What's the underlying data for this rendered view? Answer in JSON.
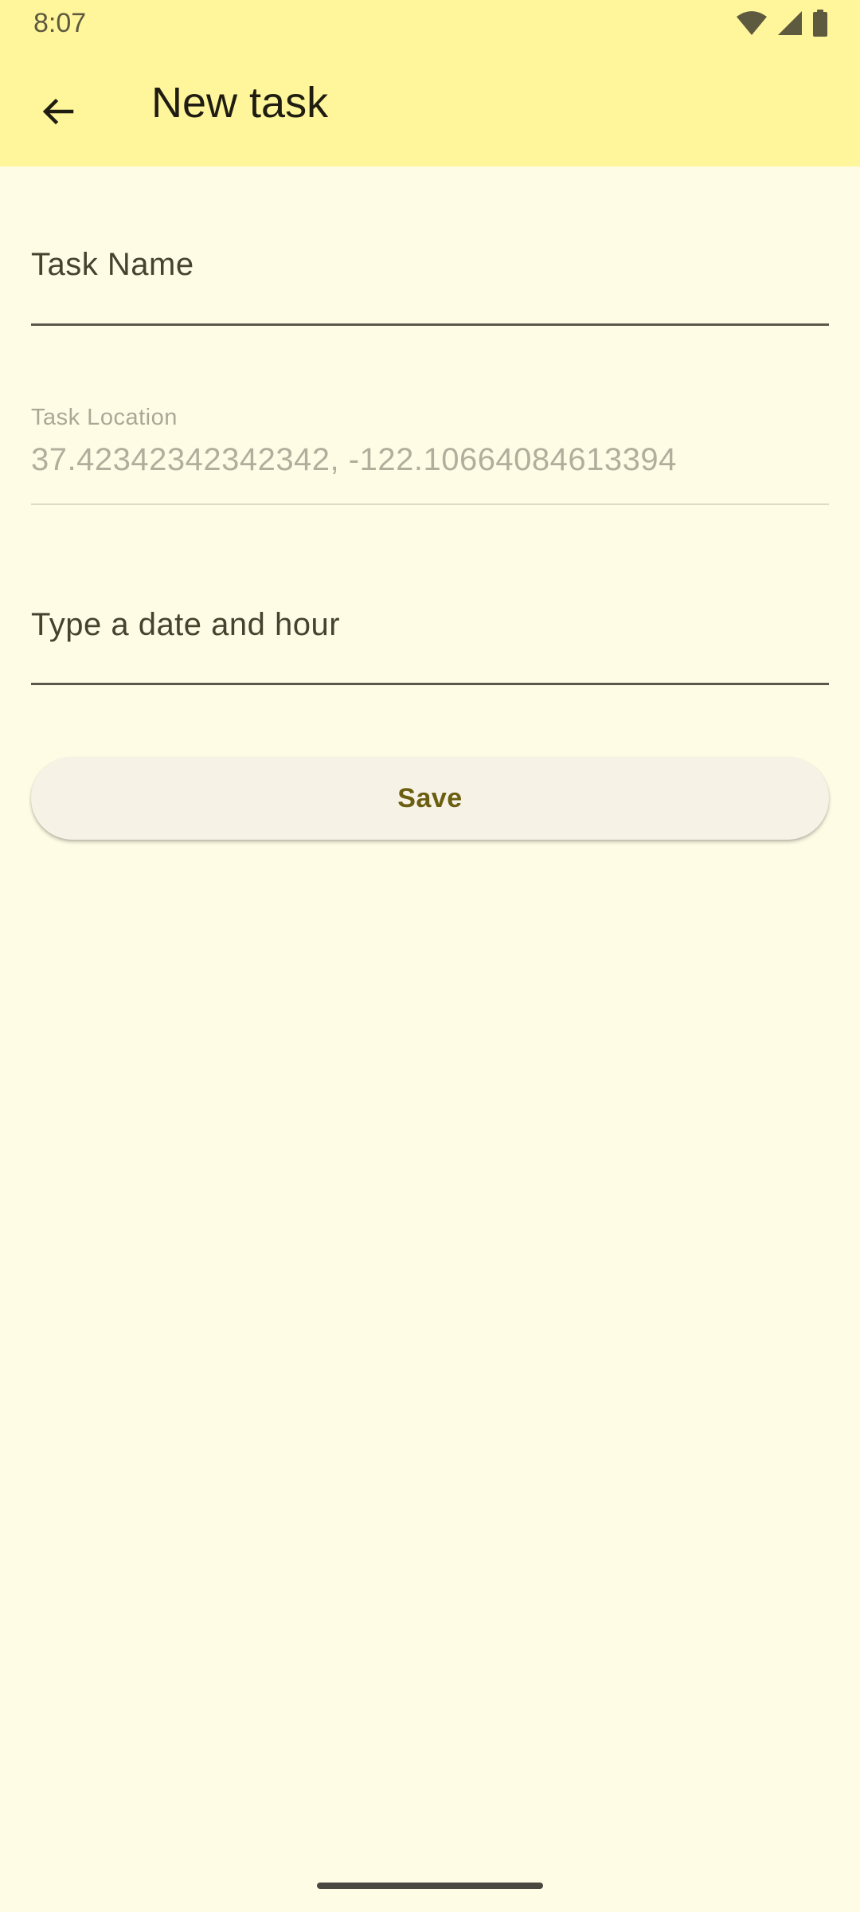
{
  "status_bar": {
    "time": "8:07",
    "icons": [
      "wifi-icon",
      "signal-icon",
      "battery-icon"
    ]
  },
  "app_bar": {
    "title": "New task",
    "back_icon": "arrow-back-icon"
  },
  "form": {
    "task_name": {
      "label": "Task Name",
      "value": ""
    },
    "task_location": {
      "label": "Task Location",
      "value": "37.42342342342342, -122.10664084613394",
      "enabled": false
    },
    "date_hour": {
      "label": "Type a date and hour",
      "value": ""
    },
    "save_label": "Save"
  },
  "colors": {
    "app_bar": "#fff59b",
    "background": "#fffce6",
    "button": "#f7f2e6",
    "button_text": "#6a5e10"
  }
}
